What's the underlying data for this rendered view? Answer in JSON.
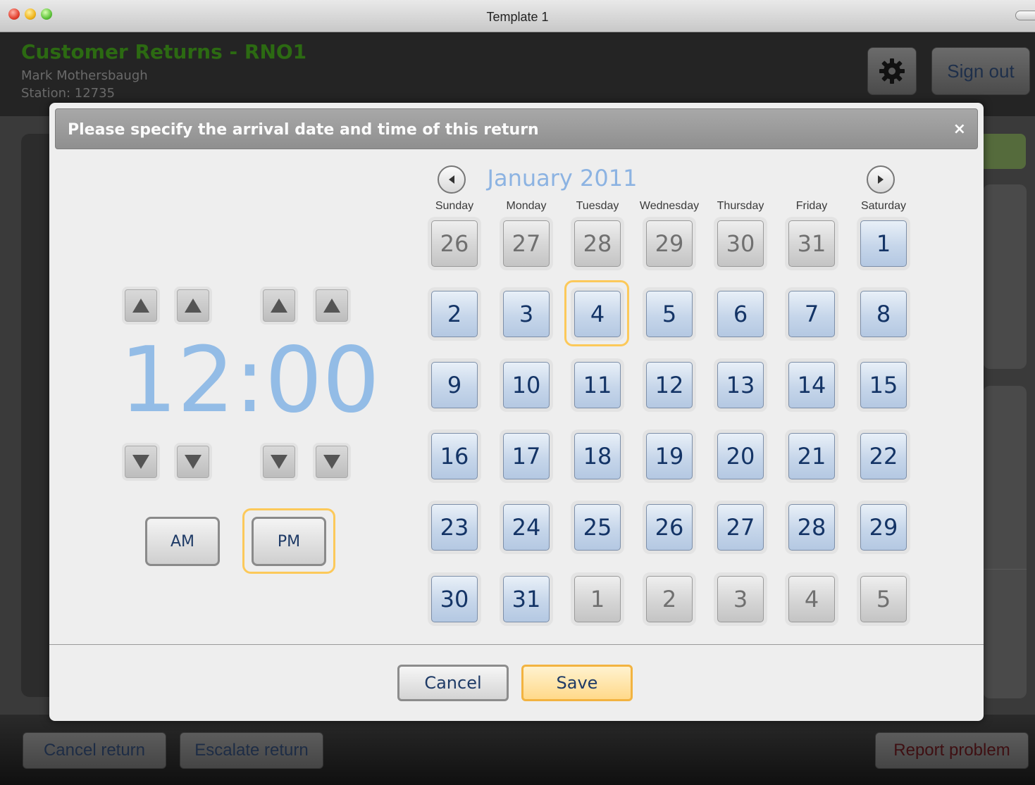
{
  "window": {
    "title": "Template 1"
  },
  "app": {
    "title": "Customer Returns - RNO1",
    "user": "Mark Mothersbaugh",
    "station": "Station: 12735",
    "signout_label": "Sign out",
    "settings_icon": "gear-icon"
  },
  "footer": {
    "cancel_return": "Cancel return",
    "escalate_return": "Escalate return",
    "report_problem": "Report problem"
  },
  "dialog": {
    "title": "Please specify the arrival date and time of this return",
    "close_label": "×",
    "time": "12:00",
    "am_label": "AM",
    "pm_label": "PM",
    "selected_period": "PM",
    "cancel_label": "Cancel",
    "save_label": "Save",
    "accent_color": "#fcc95a"
  },
  "calendar": {
    "month_title": "January 2011",
    "weekdays": [
      "Sunday",
      "Monday",
      "Tuesday",
      "Wednesday",
      "Thursday",
      "Friday",
      "Saturday"
    ],
    "selected_day": "4",
    "weeks": [
      [
        {
          "d": "26",
          "cur": false
        },
        {
          "d": "27",
          "cur": false
        },
        {
          "d": "28",
          "cur": false
        },
        {
          "d": "29",
          "cur": false
        },
        {
          "d": "30",
          "cur": false
        },
        {
          "d": "31",
          "cur": false
        },
        {
          "d": "1",
          "cur": true
        }
      ],
      [
        {
          "d": "2",
          "cur": true
        },
        {
          "d": "3",
          "cur": true
        },
        {
          "d": "4",
          "cur": true
        },
        {
          "d": "5",
          "cur": true
        },
        {
          "d": "6",
          "cur": true
        },
        {
          "d": "7",
          "cur": true
        },
        {
          "d": "8",
          "cur": true
        }
      ],
      [
        {
          "d": "9",
          "cur": true
        },
        {
          "d": "10",
          "cur": true
        },
        {
          "d": "11",
          "cur": true
        },
        {
          "d": "12",
          "cur": true
        },
        {
          "d": "13",
          "cur": true
        },
        {
          "d": "14",
          "cur": true
        },
        {
          "d": "15",
          "cur": true
        }
      ],
      [
        {
          "d": "16",
          "cur": true
        },
        {
          "d": "17",
          "cur": true
        },
        {
          "d": "18",
          "cur": true
        },
        {
          "d": "19",
          "cur": true
        },
        {
          "d": "20",
          "cur": true
        },
        {
          "d": "21",
          "cur": true
        },
        {
          "d": "22",
          "cur": true
        }
      ],
      [
        {
          "d": "23",
          "cur": true
        },
        {
          "d": "24",
          "cur": true
        },
        {
          "d": "25",
          "cur": true
        },
        {
          "d": "26",
          "cur": true
        },
        {
          "d": "27",
          "cur": true
        },
        {
          "d": "28",
          "cur": true
        },
        {
          "d": "29",
          "cur": true
        }
      ],
      [
        {
          "d": "30",
          "cur": true
        },
        {
          "d": "31",
          "cur": true
        },
        {
          "d": "1",
          "cur": false
        },
        {
          "d": "2",
          "cur": false
        },
        {
          "d": "3",
          "cur": false
        },
        {
          "d": "4",
          "cur": false
        },
        {
          "d": "5",
          "cur": false
        }
      ]
    ]
  }
}
